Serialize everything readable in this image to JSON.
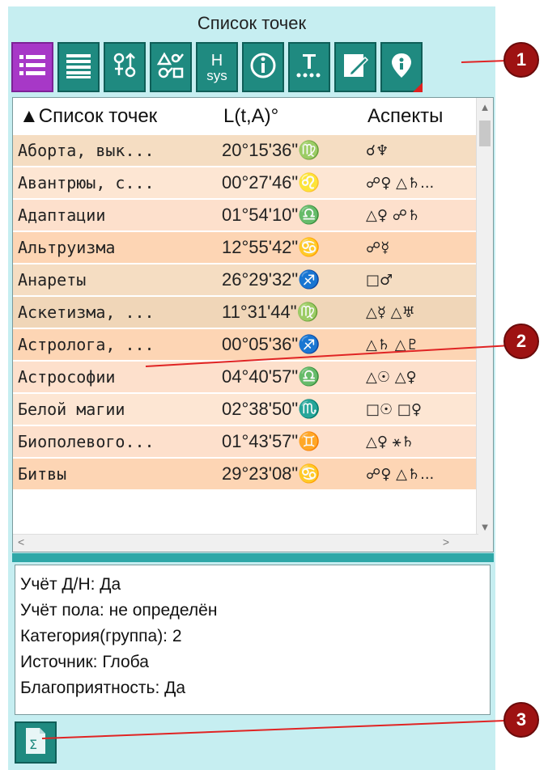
{
  "panel": {
    "title": "Список точек"
  },
  "toolbar": {
    "buttons": [
      {
        "name": "list-view-button",
        "icon": "list-icon",
        "active": true
      },
      {
        "name": "table-view-button",
        "icon": "lines-icon"
      },
      {
        "name": "planets-button",
        "icon": "planet-symbols-icon"
      },
      {
        "name": "aspects-button",
        "icon": "aspect-symbols-icon"
      },
      {
        "name": "house-system-button",
        "icon": "hsys-icon",
        "label_top": "H",
        "label_bottom": "sys"
      },
      {
        "name": "info-button",
        "icon": "info-icon"
      },
      {
        "name": "t-dots-button",
        "icon": "t-dots-icon",
        "label": "T"
      },
      {
        "name": "edit-button",
        "icon": "edit-icon"
      },
      {
        "name": "point-pin-button",
        "icon": "map-pin-icon"
      }
    ]
  },
  "table": {
    "headers": {
      "name": "▲Список точек",
      "longitude": "L(t,A)°",
      "aspects": "Аспекты"
    },
    "rows": [
      {
        "name": "Аборта, вык...",
        "longitude": "20°15'36\"♍",
        "aspects": "☌♆",
        "bg": "#f5ddc2"
      },
      {
        "name": "Авантрюы, с...",
        "longitude": "00°27'46\"♌",
        "aspects": "☍♀ △♄...",
        "bg": "#fde6d3"
      },
      {
        "name": "Адаптации",
        "longitude": "01°54'10\"♎",
        "aspects": "△♀ ☍♄",
        "bg": "#fde0cc"
      },
      {
        "name": "Альтруизма",
        "longitude": "12°55'42\"♋",
        "aspects": "☍☿",
        "bg": "#fdd5b4"
      },
      {
        "name": "Анареты",
        "longitude": "26°29'32\"♐",
        "aspects": "□♂",
        "bg": "#f5ddc2"
      },
      {
        "name": "Аскетизма, ...",
        "longitude": "11°31'44\"♍",
        "aspects": "△☿ △♅",
        "bg": "#f0d6b8"
      },
      {
        "name": "Астролога, ...",
        "longitude": "00°05'36\"♐",
        "aspects": "△♄ △♇",
        "bg": "#fdd5b4"
      },
      {
        "name": "Астрософии",
        "longitude": "04°40'57\"♎",
        "aspects": "△☉ △♀",
        "bg": "#fde0cc"
      },
      {
        "name": "Белой магии",
        "longitude": "02°38'50\"♏",
        "aspects": "□☉ □♀",
        "bg": "#fde6d3"
      },
      {
        "name": "Биополевого...",
        "longitude": "01°43'57\"♊",
        "aspects": "△♀ ⚹♄",
        "bg": "#fde0cc"
      },
      {
        "name": "Битвы",
        "longitude": "29°23'08\"♋",
        "aspects": "☍♀ △♄...",
        "bg": "#fdd5b4"
      }
    ]
  },
  "info": {
    "lines": [
      "Учёт Д/Н: Да",
      "Учёт пола: не определён",
      "Категория(группа): 2",
      "Источник: Глоба",
      "Благоприятность: Да"
    ]
  },
  "sum_button": {
    "icon": "sigma-document-icon"
  },
  "callouts": [
    {
      "label": "1"
    },
    {
      "label": "2"
    },
    {
      "label": "3"
    }
  ],
  "colors": {
    "panel": "#c6eef1",
    "button": "#1f8a80",
    "active_button": "#a738c7",
    "accent_red": "#9e1212"
  }
}
